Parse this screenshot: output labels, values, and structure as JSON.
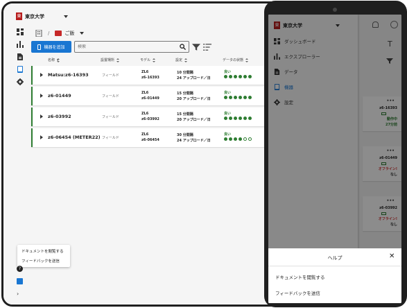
{
  "org": {
    "logo_text": "東",
    "name": "東京大学"
  },
  "breadcrumb": {
    "separator": "/",
    "folder": "ご飯"
  },
  "toolbar": {
    "add_label": "機器を追加",
    "search_placeholder": "検索"
  },
  "table": {
    "headers": [
      "名称",
      "設置場所",
      "モデル",
      "設定",
      "データの状態"
    ],
    "rows": [
      {
        "name": "Matsu:z6-16393",
        "site": "フィールド",
        "model": "ZL6",
        "sn": "z6-16393",
        "interval": "10 分間隔",
        "upload": "24 アップロード／日",
        "status": "良い",
        "quality": 6
      },
      {
        "name": "z6-01449",
        "site": "フィールド",
        "model": "ZL6",
        "sn": "z6-01449",
        "interval": "15 分間隔",
        "upload": "20 アップロード／日",
        "status": "良い",
        "quality": 6
      },
      {
        "name": "z6-03992",
        "site": "フィールド",
        "model": "ZL6",
        "sn": "z6-03992",
        "interval": "15 分間隔",
        "upload": "20 アップロード／日",
        "status": "良い",
        "quality": 6
      },
      {
        "name": "z6-06454 (METER22)",
        "site": "フィールド",
        "model": "ZL6",
        "sn": "z6-06454",
        "interval": "30 分間隔",
        "upload": "24 アップロード／日",
        "status": "良い",
        "quality": 4
      }
    ]
  },
  "help_popover": {
    "docs": "ドキュメントを閲覧する",
    "feedback": "フィードバックを送信"
  },
  "help_icon": "?",
  "collapse_chevron": "›",
  "phone": {
    "org_name": "東京大学",
    "nav": [
      "ダッシュボード",
      "エクスプローラー",
      "データ",
      "機器",
      "設定"
    ],
    "active_nav": "機器",
    "bg_letter": "T",
    "cards": [
      {
        "more": "•••",
        "sn": "z6-16393",
        "l3": "動作中",
        "l4": "27分前"
      },
      {
        "more": "•••",
        "sn": "z6-01449",
        "l3": "オフライン!",
        "l4": "なし"
      },
      {
        "more": "•••",
        "sn": "z6-03992",
        "l3": "オフライン!",
        "l4": "なし"
      }
    ],
    "sheet": {
      "title": "ヘルプ",
      "close": "✕",
      "docs": "ドキュメントを閲覧する",
      "feedback": "フィードバックを送信"
    }
  },
  "colors": {
    "accent": "#1976d2",
    "good": "#2e7d32",
    "brand": "#b71c1c",
    "offline": "#d32f2f"
  }
}
